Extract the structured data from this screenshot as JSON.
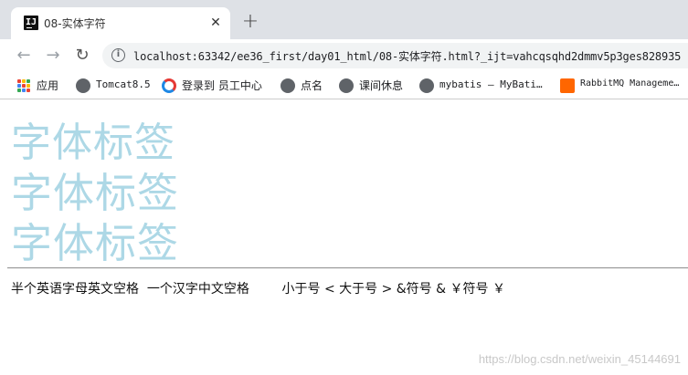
{
  "tab": {
    "title": "08-实体字符",
    "close_glyph": "✕",
    "favicon_glyph": "IJ"
  },
  "new_tab_glyph": "+",
  "toolbar": {
    "back_glyph": "←",
    "forward_glyph": "→",
    "reload_glyph": "↻",
    "info_glyph": "i",
    "url": "localhost:63342/ee36_first/day01_html/08-实体字符.html?_ijt=vahcqsqhd2dmmv5p3ges828935"
  },
  "bookmarks": [
    {
      "label": "应用",
      "icon": "apps-icon"
    },
    {
      "label": "Tomcat8.5",
      "icon": "globe-icon"
    },
    {
      "label": "登录到 员工中心",
      "icon": "swirl-icon"
    },
    {
      "label": "点名",
      "icon": "globe-icon"
    },
    {
      "label": "课间休息",
      "icon": "globe-icon"
    },
    {
      "label": "mybatis – MyBati…",
      "icon": "globe-icon"
    },
    {
      "label": "RabbitMQ Manageme…",
      "icon": "rabbitmq-icon"
    }
  ],
  "page": {
    "font_lines": [
      "字体标签",
      "字体标签",
      "字体标签"
    ],
    "font_color": "#add8e6",
    "entity_line": "半个英语字母英文空格  一个汉字中文空格        小于号 < 大于号 > &符号 & ￥符号 ￥",
    "watermark": "https://blog.csdn.net/weixin_45144691"
  }
}
